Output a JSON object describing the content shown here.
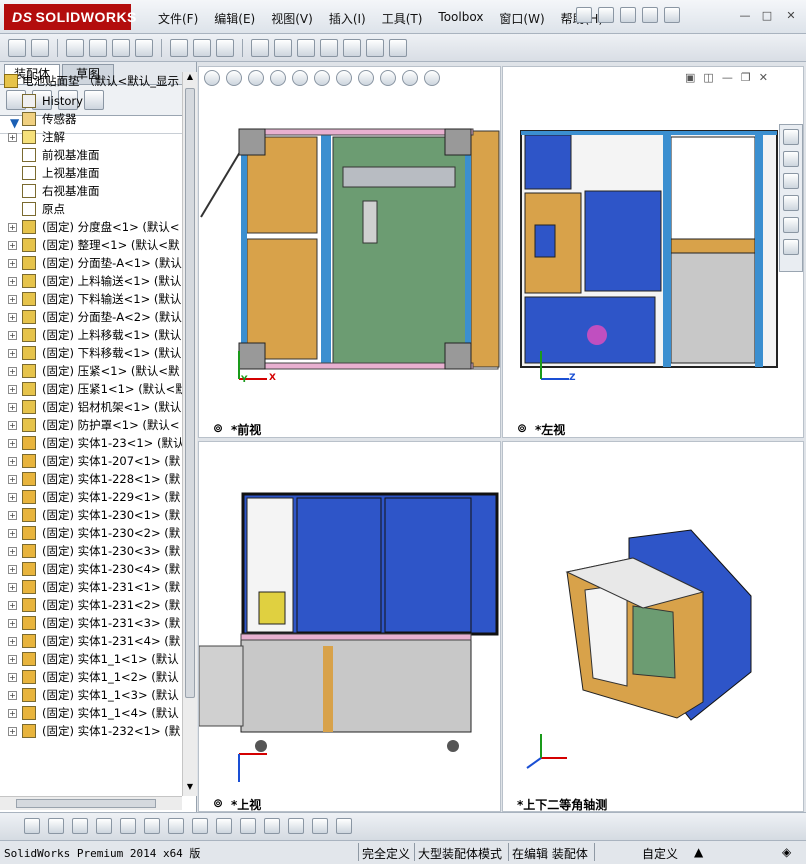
{
  "app": {
    "logo_text": "SOLIDWORKS",
    "logo_prefix": "DS"
  },
  "menu": [
    "文件(F)",
    "编辑(E)",
    "视图(V)",
    "插入(I)",
    "工具(T)",
    "Toolbox",
    "窗口(W)",
    "帮助(H)"
  ],
  "window_controls": {
    "minimize": "—",
    "restore": "□",
    "close": "✕"
  },
  "panel_tabs": {
    "assembly": "装配体",
    "sketch": "草图"
  },
  "filter_icon": "funnel-icon",
  "tree": {
    "root": "电池贴面垫 （默认<默认_显示",
    "items": [
      {
        "label": "History",
        "type": "history",
        "indent": 1,
        "expand": false
      },
      {
        "label": "传感器",
        "type": "sensor",
        "indent": 1,
        "expand": false
      },
      {
        "label": "注解",
        "type": "annotation",
        "indent": 1,
        "expand": true
      },
      {
        "label": "前视基准面",
        "type": "plane",
        "indent": 1,
        "expand": false
      },
      {
        "label": "上视基准面",
        "type": "plane",
        "indent": 1,
        "expand": false
      },
      {
        "label": "右视基准面",
        "type": "plane",
        "indent": 1,
        "expand": false
      },
      {
        "label": "原点",
        "type": "origin",
        "indent": 1,
        "expand": false
      },
      {
        "label": "(固定) 分度盘<1> (默认<",
        "type": "asm",
        "indent": 1,
        "expand": true
      },
      {
        "label": "(固定) 整理<1> (默认<默",
        "type": "asm",
        "indent": 1,
        "expand": true
      },
      {
        "label": "(固定) 分面垫-A<1> (默认",
        "type": "asm",
        "indent": 1,
        "expand": true
      },
      {
        "label": "(固定) 上料输送<1> (默认",
        "type": "asm",
        "indent": 1,
        "expand": true
      },
      {
        "label": "(固定) 下料输送<1> (默认",
        "type": "asm",
        "indent": 1,
        "expand": true
      },
      {
        "label": "(固定) 分面垫-A<2> (默认",
        "type": "asm",
        "indent": 1,
        "expand": true
      },
      {
        "label": "(固定) 上料移载<1> (默认",
        "type": "asm",
        "indent": 1,
        "expand": true
      },
      {
        "label": "(固定) 下料移载<1> (默认",
        "type": "asm",
        "indent": 1,
        "expand": true
      },
      {
        "label": "(固定) 压紧<1> (默认<默",
        "type": "asm",
        "indent": 1,
        "expand": true
      },
      {
        "label": "(固定) 压紧1<1> (默认<默",
        "type": "asm",
        "indent": 1,
        "expand": true
      },
      {
        "label": "(固定) 铝材机架<1> (默认",
        "type": "asm",
        "indent": 1,
        "expand": true
      },
      {
        "label": "(固定) 防护罩<1> (默认<",
        "type": "asm",
        "indent": 1,
        "expand": true
      },
      {
        "label": "(固定) 实体1-23<1> (默认",
        "type": "part",
        "indent": 1,
        "expand": true
      },
      {
        "label": "(固定) 实体1-207<1> (默",
        "type": "part",
        "indent": 1,
        "expand": true
      },
      {
        "label": "(固定) 实体1-228<1> (默",
        "type": "part",
        "indent": 1,
        "expand": true
      },
      {
        "label": "(固定) 实体1-229<1> (默",
        "type": "part",
        "indent": 1,
        "expand": true
      },
      {
        "label": "(固定) 实体1-230<1> (默",
        "type": "part",
        "indent": 1,
        "expand": true
      },
      {
        "label": "(固定) 实体1-230<2> (默",
        "type": "part",
        "indent": 1,
        "expand": true
      },
      {
        "label": "(固定) 实体1-230<3> (默",
        "type": "part",
        "indent": 1,
        "expand": true
      },
      {
        "label": "(固定) 实体1-230<4> (默",
        "type": "part",
        "indent": 1,
        "expand": true
      },
      {
        "label": "(固定) 实体1-231<1> (默",
        "type": "part",
        "indent": 1,
        "expand": true
      },
      {
        "label": "(固定) 实体1-231<2> (默",
        "type": "part",
        "indent": 1,
        "expand": true
      },
      {
        "label": "(固定) 实体1-231<3> (默",
        "type": "part",
        "indent": 1,
        "expand": true
      },
      {
        "label": "(固定) 实体1-231<4> (默",
        "type": "part",
        "indent": 1,
        "expand": true
      },
      {
        "label": "(固定) 实体1_1<1> (默认",
        "type": "part",
        "indent": 1,
        "expand": true
      },
      {
        "label": "(固定) 实体1_1<2> (默认",
        "type": "part",
        "indent": 1,
        "expand": true
      },
      {
        "label": "(固定) 实体1_1<3> (默认",
        "type": "part",
        "indent": 1,
        "expand": true
      },
      {
        "label": "(固定) 实体1_1<4> (默认",
        "type": "part",
        "indent": 1,
        "expand": true
      },
      {
        "label": "(固定) 实体1-232<1> (默",
        "type": "part",
        "indent": 1,
        "expand": true
      }
    ]
  },
  "viewports": {
    "front": "*前视",
    "left": "*左视",
    "top": "*上视",
    "iso": "*上下二等角轴测"
  },
  "axes": {
    "x": "X",
    "y": "Y",
    "z": "Z"
  },
  "status": {
    "product": "SolidWorks Premium 2014 x64 版",
    "defined": "完全定义",
    "mode": "大型装配体模式",
    "editing": "在编辑 装配体",
    "custom": "自定义"
  },
  "colors": {
    "accent": "#b30d0d",
    "blue": "#2e55c8",
    "wood": "#d8a24a",
    "frame": "#3b8fd0"
  }
}
